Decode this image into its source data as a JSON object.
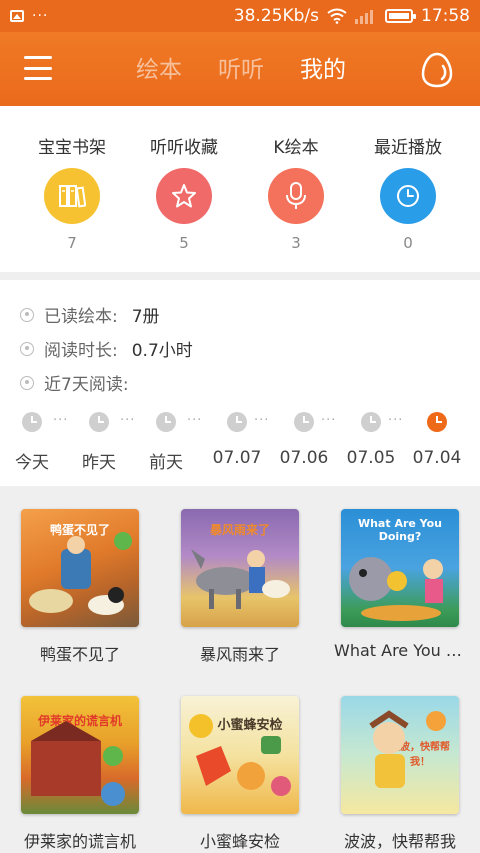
{
  "status_bar": {
    "dots": "···",
    "network_speed": "38.25Kb/s",
    "time": "17:58"
  },
  "header": {
    "tabs": [
      {
        "label": "绘本",
        "active": false
      },
      {
        "label": "听听",
        "active": false
      },
      {
        "label": "我的",
        "active": true
      }
    ],
    "accent_color": "#ec6e1f"
  },
  "shortcuts": [
    {
      "label": "宝宝书架",
      "count": "7",
      "icon": "bookshelf-icon",
      "color": "#f6c232"
    },
    {
      "label": "听听收藏",
      "count": "5",
      "icon": "star-icon",
      "color": "#f06a6a"
    },
    {
      "label": "K绘本",
      "count": "3",
      "icon": "microphone-icon",
      "color": "#f4715c"
    },
    {
      "label": "最近播放",
      "count": "0",
      "icon": "clock-icon",
      "color": "#2a9de8"
    }
  ],
  "stats": {
    "read_label": "已读绘本:",
    "read_value": "7册",
    "duration_label": "阅读时长:",
    "duration_value": "0.7小时",
    "recent_label": "近7天阅读:"
  },
  "days": [
    {
      "label": "今天",
      "active": false
    },
    {
      "label": "昨天",
      "active": false
    },
    {
      "label": "前天",
      "active": false
    },
    {
      "label": "07.07",
      "active": false
    },
    {
      "label": "07.06",
      "active": false
    },
    {
      "label": "07.05",
      "active": false
    },
    {
      "label": "07.04",
      "active": true
    }
  ],
  "day_dots": "···",
  "books": [
    {
      "title": "鸭蛋不见了",
      "cover_text": "鸭蛋不见了"
    },
    {
      "title": "暴风雨来了",
      "cover_text": "暴风雨来了"
    },
    {
      "title": "What Are You Doing?",
      "cover_text": "What Are You Doing?"
    },
    {
      "title": "伊莱家的谎言机",
      "cover_text": "伊莱家的谎言机"
    },
    {
      "title": "小蜜蜂安检",
      "cover_text": "小蜜蜂安检"
    },
    {
      "title": "波波，快帮帮我",
      "cover_text": "波波，快帮帮我！"
    }
  ]
}
